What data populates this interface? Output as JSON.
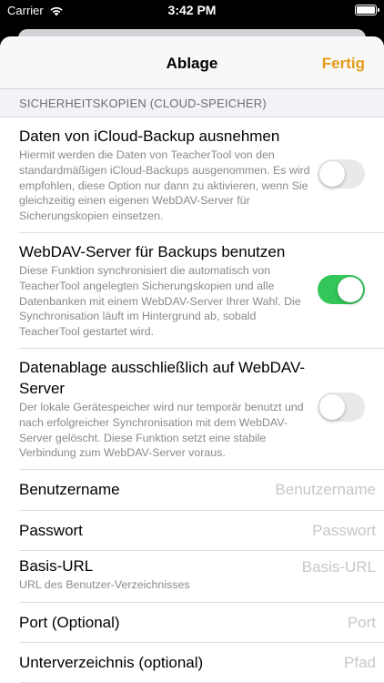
{
  "status": {
    "carrier": "Carrier",
    "time": "3:42 PM"
  },
  "nav": {
    "title": "Ablage",
    "done_label": "Fertig",
    "accent_color": "#e69b1a"
  },
  "section_header": "SICHERHEITSKOPIEN (CLOUD-SPEICHER)",
  "toggle_rows": [
    {
      "title": "Daten von iCloud-Backup ausnehmen",
      "description": "Hiermit werden die Daten von TeacherTool von den standardmäßigen iCloud-Backups ausgenommen. Es wird empfohlen, diese Option nur dann zu aktivieren, wenn Sie gleichzeitig einen eigenen WebDAV-Server für Sicherungskopien einsetzen.",
      "on": false
    },
    {
      "title": "WebDAV-Server für Backups benutzen",
      "description": "Diese Funktion synchronisiert die automatisch von TeacherTool angelegten Sicherungskopien und alle Datenbanken mit einem WebDAV-Server Ihrer Wahl. Die Synchronisation läuft im Hintergrund ab, sobald TeacherTool gestartet wird.",
      "on": true
    },
    {
      "title": "Datenablage ausschließlich auf WebDAV-Server",
      "description": "Der lokale Gerätespeicher wird nur temporär benutzt und nach erfolgreicher Synchronisation mit dem WebDAV-Server gelöscht. Diese Funktion setzt eine stabile Verbindung zum WebDAV-Server voraus.",
      "on": false
    }
  ],
  "fields": {
    "username": {
      "label": "Benutzername",
      "placeholder": "Benutzername",
      "value": ""
    },
    "password": {
      "label": "Passwort",
      "placeholder": "Passwort",
      "value": ""
    },
    "base_url": {
      "label": "Basis-URL",
      "placeholder": "Basis-URL",
      "sublabel": "URL des Benutzer-Verzeichnisses",
      "value": ""
    },
    "port": {
      "label": "Port (Optional)",
      "placeholder": "Port",
      "value": ""
    },
    "subdirectory": {
      "label": "Unterverzeichnis (optional)",
      "placeholder": "Pfad",
      "value": ""
    }
  },
  "colors": {
    "toggle_on": "#33c659",
    "toggle_off": "#e9e9eb"
  }
}
